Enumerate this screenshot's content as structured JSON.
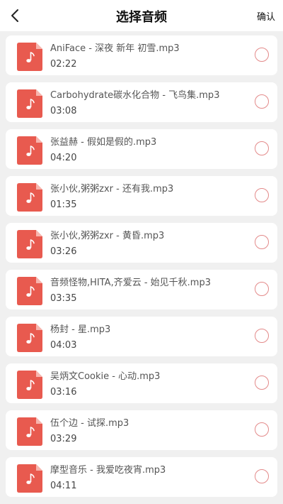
{
  "header": {
    "title": "选择音频",
    "confirm_label": "确认"
  },
  "colors": {
    "accent": "#e85a4f",
    "radio_border": "#e38a8a",
    "background": "#f0f0f0"
  },
  "items": [
    {
      "name": "AniFace - 深夜 新年 初雪.mp3",
      "duration": "02:22",
      "icon": "music-file-icon"
    },
    {
      "name": "Carbohydrate碳水化合物 - 飞鸟集.mp3",
      "duration": "03:08",
      "icon": "music-file-icon"
    },
    {
      "name": "张益赫 - 假如是假的.mp3",
      "duration": "04:20",
      "icon": "music-file-icon"
    },
    {
      "name": "张小伙,粥粥zxr - 还有我.mp3",
      "duration": "01:35",
      "icon": "music-file-icon"
    },
    {
      "name": "张小伙,粥粥zxr - 黄昏.mp3",
      "duration": "03:26",
      "icon": "music-file-icon"
    },
    {
      "name": "音频怪物,HITA,齐爱云 - 始见千秋.mp3",
      "duration": "03:35",
      "icon": "music-file-icon"
    },
    {
      "name": "杨封 - 星.mp3",
      "duration": "04:03",
      "icon": "music-file-icon"
    },
    {
      "name": "吴炳文Cookie - 心动.mp3",
      "duration": "03:16",
      "icon": "music-file-icon"
    },
    {
      "name": "伍个边 - 试探.mp3",
      "duration": "03:29",
      "icon": "music-file-icon"
    },
    {
      "name": "摩型音乐 - 我爱吃夜宵.mp3",
      "duration": "04:11",
      "icon": "music-file-icon"
    }
  ]
}
